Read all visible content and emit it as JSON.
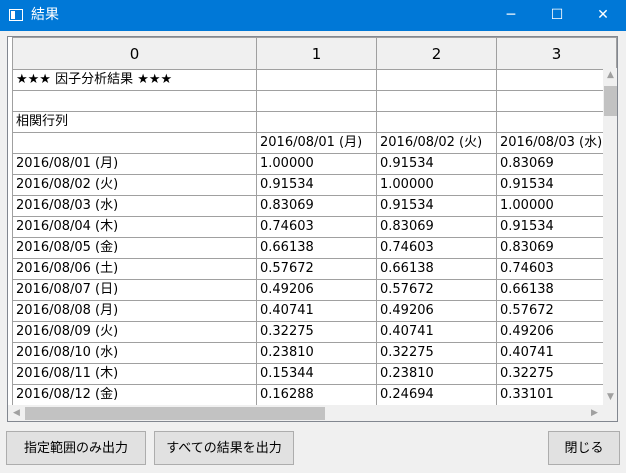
{
  "window": {
    "title": "結果",
    "minimize_icon": "─",
    "maximize_icon": "☐",
    "close_icon": "✕"
  },
  "grid": {
    "columns": [
      "0",
      "1",
      "2",
      "3"
    ],
    "rows": [
      [
        "★★★ 因子分析結果 ★★★",
        "",
        "",
        ""
      ],
      [
        "",
        "",
        "",
        ""
      ],
      [
        "相関行列",
        "",
        "",
        ""
      ],
      [
        "",
        "2016/08/01 (月)",
        "2016/08/02 (火)",
        "2016/08/03 (水)"
      ],
      [
        "2016/08/01 (月)",
        "1.00000",
        "0.91534",
        "0.83069"
      ],
      [
        "2016/08/02 (火)",
        "0.91534",
        "1.00000",
        "0.91534"
      ],
      [
        "2016/08/03 (水)",
        "0.83069",
        "0.91534",
        "1.00000"
      ],
      [
        "2016/08/04 (木)",
        "0.74603",
        "0.83069",
        "0.91534"
      ],
      [
        "2016/08/05 (金)",
        "0.66138",
        "0.74603",
        "0.83069"
      ],
      [
        "2016/08/06 (土)",
        "0.57672",
        "0.66138",
        "0.74603"
      ],
      [
        "2016/08/07 (日)",
        "0.49206",
        "0.57672",
        "0.66138"
      ],
      [
        "2016/08/08 (月)",
        "0.40741",
        "0.49206",
        "0.57672"
      ],
      [
        "2016/08/09 (火)",
        "0.32275",
        "0.40741",
        "0.49206"
      ],
      [
        "2016/08/10 (水)",
        "0.23810",
        "0.32275",
        "0.40741"
      ],
      [
        "2016/08/11 (木)",
        "0.15344",
        "0.23810",
        "0.32275"
      ],
      [
        "2016/08/12 (金)",
        "0.16288",
        "0.24694",
        "0.33101"
      ]
    ],
    "scroll_up": "▲",
    "scroll_down": "▼",
    "scroll_left": "◀",
    "scroll_right": "▶"
  },
  "buttons": {
    "export_range": "指定範囲のみ出力",
    "export_all": "すべての結果を出力",
    "close": "閉じる"
  }
}
